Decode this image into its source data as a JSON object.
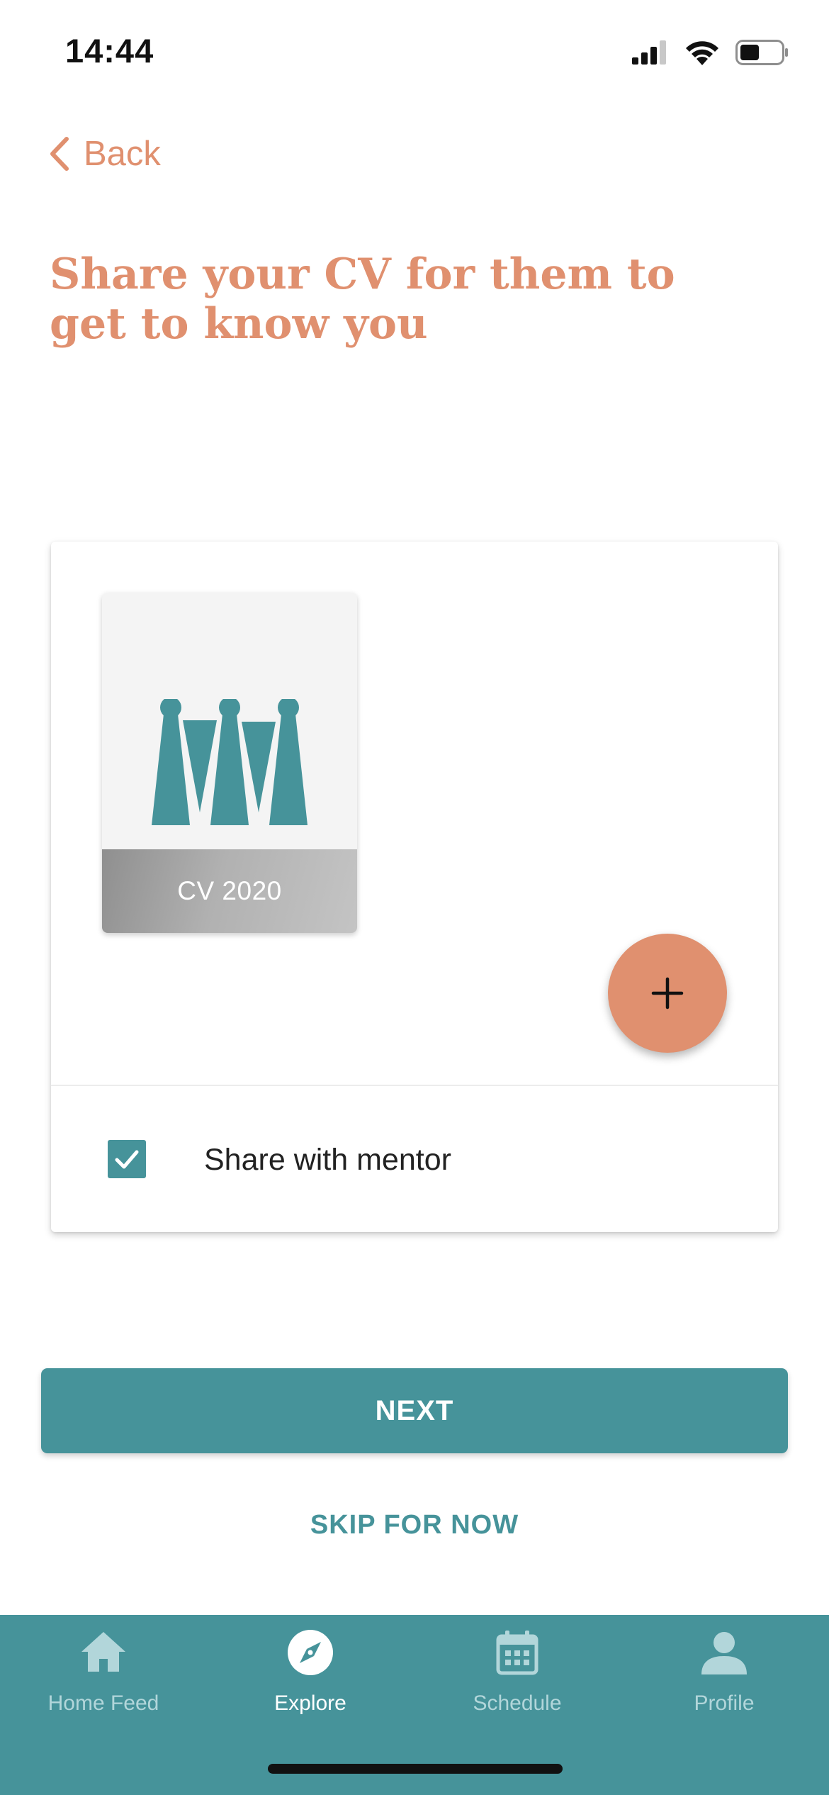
{
  "status_bar": {
    "time": "14:44",
    "icons": [
      "cellular-signal-icon",
      "wifi-icon",
      "battery-icon"
    ]
  },
  "nav": {
    "back_label": "Back",
    "back_icon": "chevron-left-icon"
  },
  "title": "Share your CV for them to get to know you",
  "cv_card": {
    "file": {
      "label": "CV 2020",
      "thumbnail_icon": "crown-logo-icon"
    },
    "add_icon": "plus-icon",
    "share_with_mentor": {
      "label": "Share with mentor",
      "checked": true
    }
  },
  "actions": {
    "next_label": "NEXT",
    "skip_label": "SKIP FOR NOW"
  },
  "tab_bar": {
    "tabs": [
      {
        "label": "Home Feed",
        "icon": "home-icon",
        "active": false
      },
      {
        "label": "Explore",
        "icon": "compass-icon",
        "active": true
      },
      {
        "label": "Schedule",
        "icon": "calendar-icon",
        "active": false
      },
      {
        "label": "Profile",
        "icon": "profile-icon",
        "active": false
      }
    ]
  },
  "colors": {
    "accent": "#e0906f",
    "primary": "#46939a",
    "tab_inactive": "#b2d6da",
    "white": "#ffffff"
  }
}
